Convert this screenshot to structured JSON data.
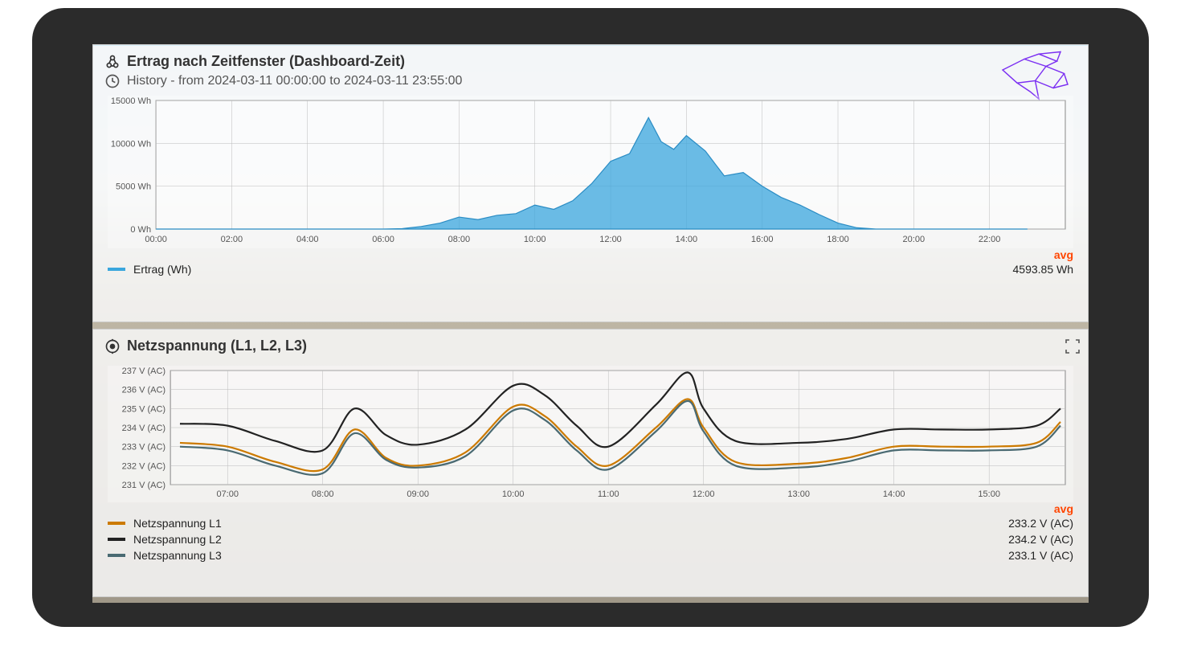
{
  "panel1": {
    "title": "Ertrag nach Zeitfenster (Dashboard-Zeit)",
    "subtitle": "History - from 2024-03-11 00:00:00 to 2024-03-11 23:55:00",
    "avg_label": "avg",
    "avg_value": "4593.85 Wh",
    "legend_series": "Ertrag (Wh)"
  },
  "panel2": {
    "title": "Netzspannung (L1, L2, L3)",
    "avg_label": "avg",
    "legend": [
      {
        "name": "Netzspannung L1",
        "color": "#cc7a00",
        "avg": "233.2 V (AC)"
      },
      {
        "name": "Netzspannung L2",
        "color": "#222222",
        "avg": "234.2 V (AC)"
      },
      {
        "name": "Netzspannung L3",
        "color": "#4a6a72",
        "avg": "233.1 V (AC)"
      }
    ]
  },
  "chart_data": [
    {
      "type": "area",
      "title": "Ertrag nach Zeitfenster (Dashboard-Zeit)",
      "xlabel": "",
      "ylabel": "",
      "y_unit": "Wh",
      "ylim": [
        0,
        15000
      ],
      "y_ticks": [
        0,
        5000,
        10000,
        15000
      ],
      "x_ticks": [
        "00:00",
        "02:00",
        "04:00",
        "06:00",
        "08:00",
        "10:00",
        "12:00",
        "14:00",
        "16:00",
        "18:00",
        "20:00",
        "22:00"
      ],
      "series": [
        {
          "name": "Ertrag (Wh)",
          "color": "#3aa6dd",
          "x": [
            "00:00",
            "01:00",
            "02:00",
            "03:00",
            "04:00",
            "05:00",
            "06:00",
            "06:30",
            "07:00",
            "07:30",
            "08:00",
            "08:30",
            "09:00",
            "09:30",
            "10:00",
            "10:30",
            "11:00",
            "11:30",
            "12:00",
            "12:30",
            "13:00",
            "13:20",
            "13:40",
            "14:00",
            "14:30",
            "15:00",
            "15:30",
            "16:00",
            "16:30",
            "17:00",
            "17:30",
            "18:00",
            "18:30",
            "19:00",
            "20:00",
            "21:00",
            "22:00",
            "23:00"
          ],
          "values": [
            0,
            0,
            0,
            0,
            0,
            0,
            0,
            50,
            300,
            700,
            1400,
            1100,
            1600,
            1800,
            2800,
            2300,
            3300,
            5300,
            7900,
            8800,
            13000,
            10200,
            9300,
            10900,
            9100,
            6200,
            6600,
            5000,
            3700,
            2800,
            1700,
            700,
            150,
            0,
            0,
            0,
            0,
            0
          ]
        }
      ]
    },
    {
      "type": "line",
      "title": "Netzspannung (L1, L2, L3)",
      "xlabel": "",
      "ylabel": "",
      "y_unit": "V (AC)",
      "ylim": [
        231,
        237
      ],
      "y_ticks": [
        231,
        232,
        233,
        234,
        235,
        236,
        237
      ],
      "x_ticks": [
        "07:00",
        "08:00",
        "09:00",
        "10:00",
        "11:00",
        "12:00",
        "13:00",
        "14:00",
        "15:00"
      ],
      "series": [
        {
          "name": "Netzspannung L1",
          "color": "#cc7a00",
          "x": [
            "06:30",
            "07:00",
            "07:30",
            "08:00",
            "08:20",
            "08:40",
            "09:00",
            "09:30",
            "10:00",
            "10:20",
            "10:40",
            "11:00",
            "11:30",
            "11:50",
            "12:00",
            "12:20",
            "13:00",
            "13:30",
            "14:00",
            "14:30",
            "15:00",
            "15:30",
            "15:45"
          ],
          "values": [
            233.2,
            233.0,
            232.2,
            231.8,
            233.9,
            232.4,
            232.0,
            232.7,
            235.1,
            234.6,
            233.0,
            232.0,
            234.0,
            235.5,
            234.0,
            232.2,
            232.1,
            232.4,
            233.0,
            233.0,
            233.0,
            233.2,
            234.3
          ]
        },
        {
          "name": "Netzspannung L2",
          "color": "#222222",
          "x": [
            "06:30",
            "07:00",
            "07:30",
            "08:00",
            "08:20",
            "08:40",
            "09:00",
            "09:30",
            "10:00",
            "10:20",
            "10:40",
            "11:00",
            "11:30",
            "11:50",
            "12:00",
            "12:20",
            "13:00",
            "13:30",
            "14:00",
            "14:30",
            "15:00",
            "15:30",
            "15:45"
          ],
          "values": [
            234.2,
            234.1,
            233.3,
            232.8,
            235.0,
            233.6,
            233.1,
            233.9,
            236.2,
            235.7,
            234.1,
            233.0,
            235.2,
            236.9,
            235.0,
            233.3,
            233.2,
            233.4,
            233.9,
            233.9,
            233.9,
            234.1,
            235.0
          ]
        },
        {
          "name": "Netzspannung L3",
          "color": "#4a6a72",
          "x": [
            "06:30",
            "07:00",
            "07:30",
            "08:00",
            "08:20",
            "08:40",
            "09:00",
            "09:30",
            "10:00",
            "10:20",
            "10:40",
            "11:00",
            "11:30",
            "11:50",
            "12:00",
            "12:20",
            "13:00",
            "13:30",
            "14:00",
            "14:30",
            "15:00",
            "15:30",
            "15:45"
          ],
          "values": [
            233.0,
            232.8,
            232.0,
            231.6,
            233.7,
            232.3,
            231.9,
            232.5,
            234.9,
            234.4,
            232.8,
            231.8,
            233.8,
            235.4,
            233.8,
            232.0,
            231.9,
            232.2,
            232.8,
            232.8,
            232.8,
            233.0,
            234.1
          ]
        }
      ]
    }
  ]
}
